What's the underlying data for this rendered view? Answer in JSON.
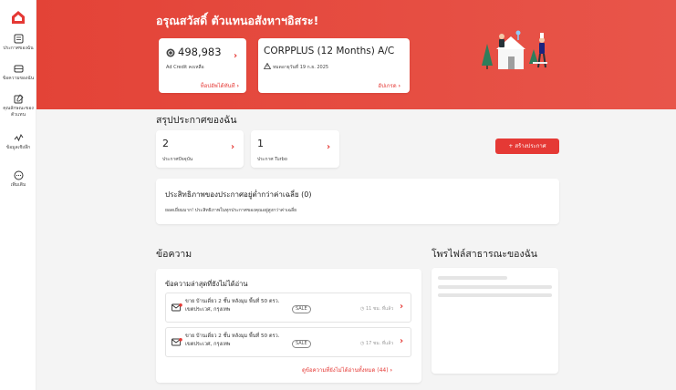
{
  "sidebar": {
    "items": [
      {
        "label": "ประกาศของฉัน",
        "icon": "listing-icon"
      },
      {
        "label": "ข้อความของฉัน",
        "icon": "message-icon"
      },
      {
        "label": "คุณลักษณะของตัวแทน",
        "icon": "agent-edit-icon"
      },
      {
        "label": "ข้อมูลเชิงลึก",
        "icon": "insights-icon"
      },
      {
        "label": "เพิ่มเติม",
        "icon": "more-icon"
      }
    ]
  },
  "header": {
    "greeting": "อรุณสวัสดิ์ ตัวแทนอสังหาฯอิสระ!"
  },
  "credit": {
    "amount": "498,983",
    "label": "Ad Credit คงเหลือ",
    "action": "ท็อปอัพได้ทันที"
  },
  "plan": {
    "name": "CORPPLUS (12 Months) A/C",
    "expiry": "หมดอายุวันที่ 19 ก.ย. 2025",
    "action": "อัปเกรด"
  },
  "summary": {
    "title": "สรุปประกาศของฉัน",
    "active": {
      "count": "2",
      "label": "ประกาศปัจจุบัน"
    },
    "turbo": {
      "count": "1",
      "label": "ประกาศ Turbo"
    },
    "create_button": "+ สร้างประกาศ"
  },
  "performance": {
    "title": "ประสิทธิภาพของประกาศอยู่ต่ำกว่าค่าเฉลี่ย (0)",
    "text": "ยอดเยี่ยมมาก! ประสิทธิภาพในทุกประกาศของคุณอยู่สูงกว่าค่าเฉลี่ย"
  },
  "messages": {
    "title": "ข้อความ",
    "card_title": "ข้อความล่าสุดที่ยังไม่ได้อ่าน",
    "items": [
      {
        "line1": "ขาย บ้านเดี่ยว 2 ชั้น หลังมุม พื้นที่ 50 ตรว.",
        "line2": "เขตประเวศ, กรุงเทพ",
        "tag": "SALE",
        "time": "11 ชม. ที่แล้ว"
      },
      {
        "line1": "ขาย บ้านเดี่ยว 2 ชั้น หลังมุม พื้นที่ 50 ตรว.",
        "line2": "เขตประเวศ, กรุงเทพ",
        "tag": "SALE",
        "time": "17 ชม. ที่แล้ว"
      }
    ],
    "view_all": "ดูข้อความที่ยังไม่ได้อ่านทั้งหมด (44)"
  },
  "profile": {
    "title": "โพรไฟล์สาธารณะของฉัน"
  },
  "colors": {
    "accent": "#e53935",
    "header": "#e5473b"
  }
}
